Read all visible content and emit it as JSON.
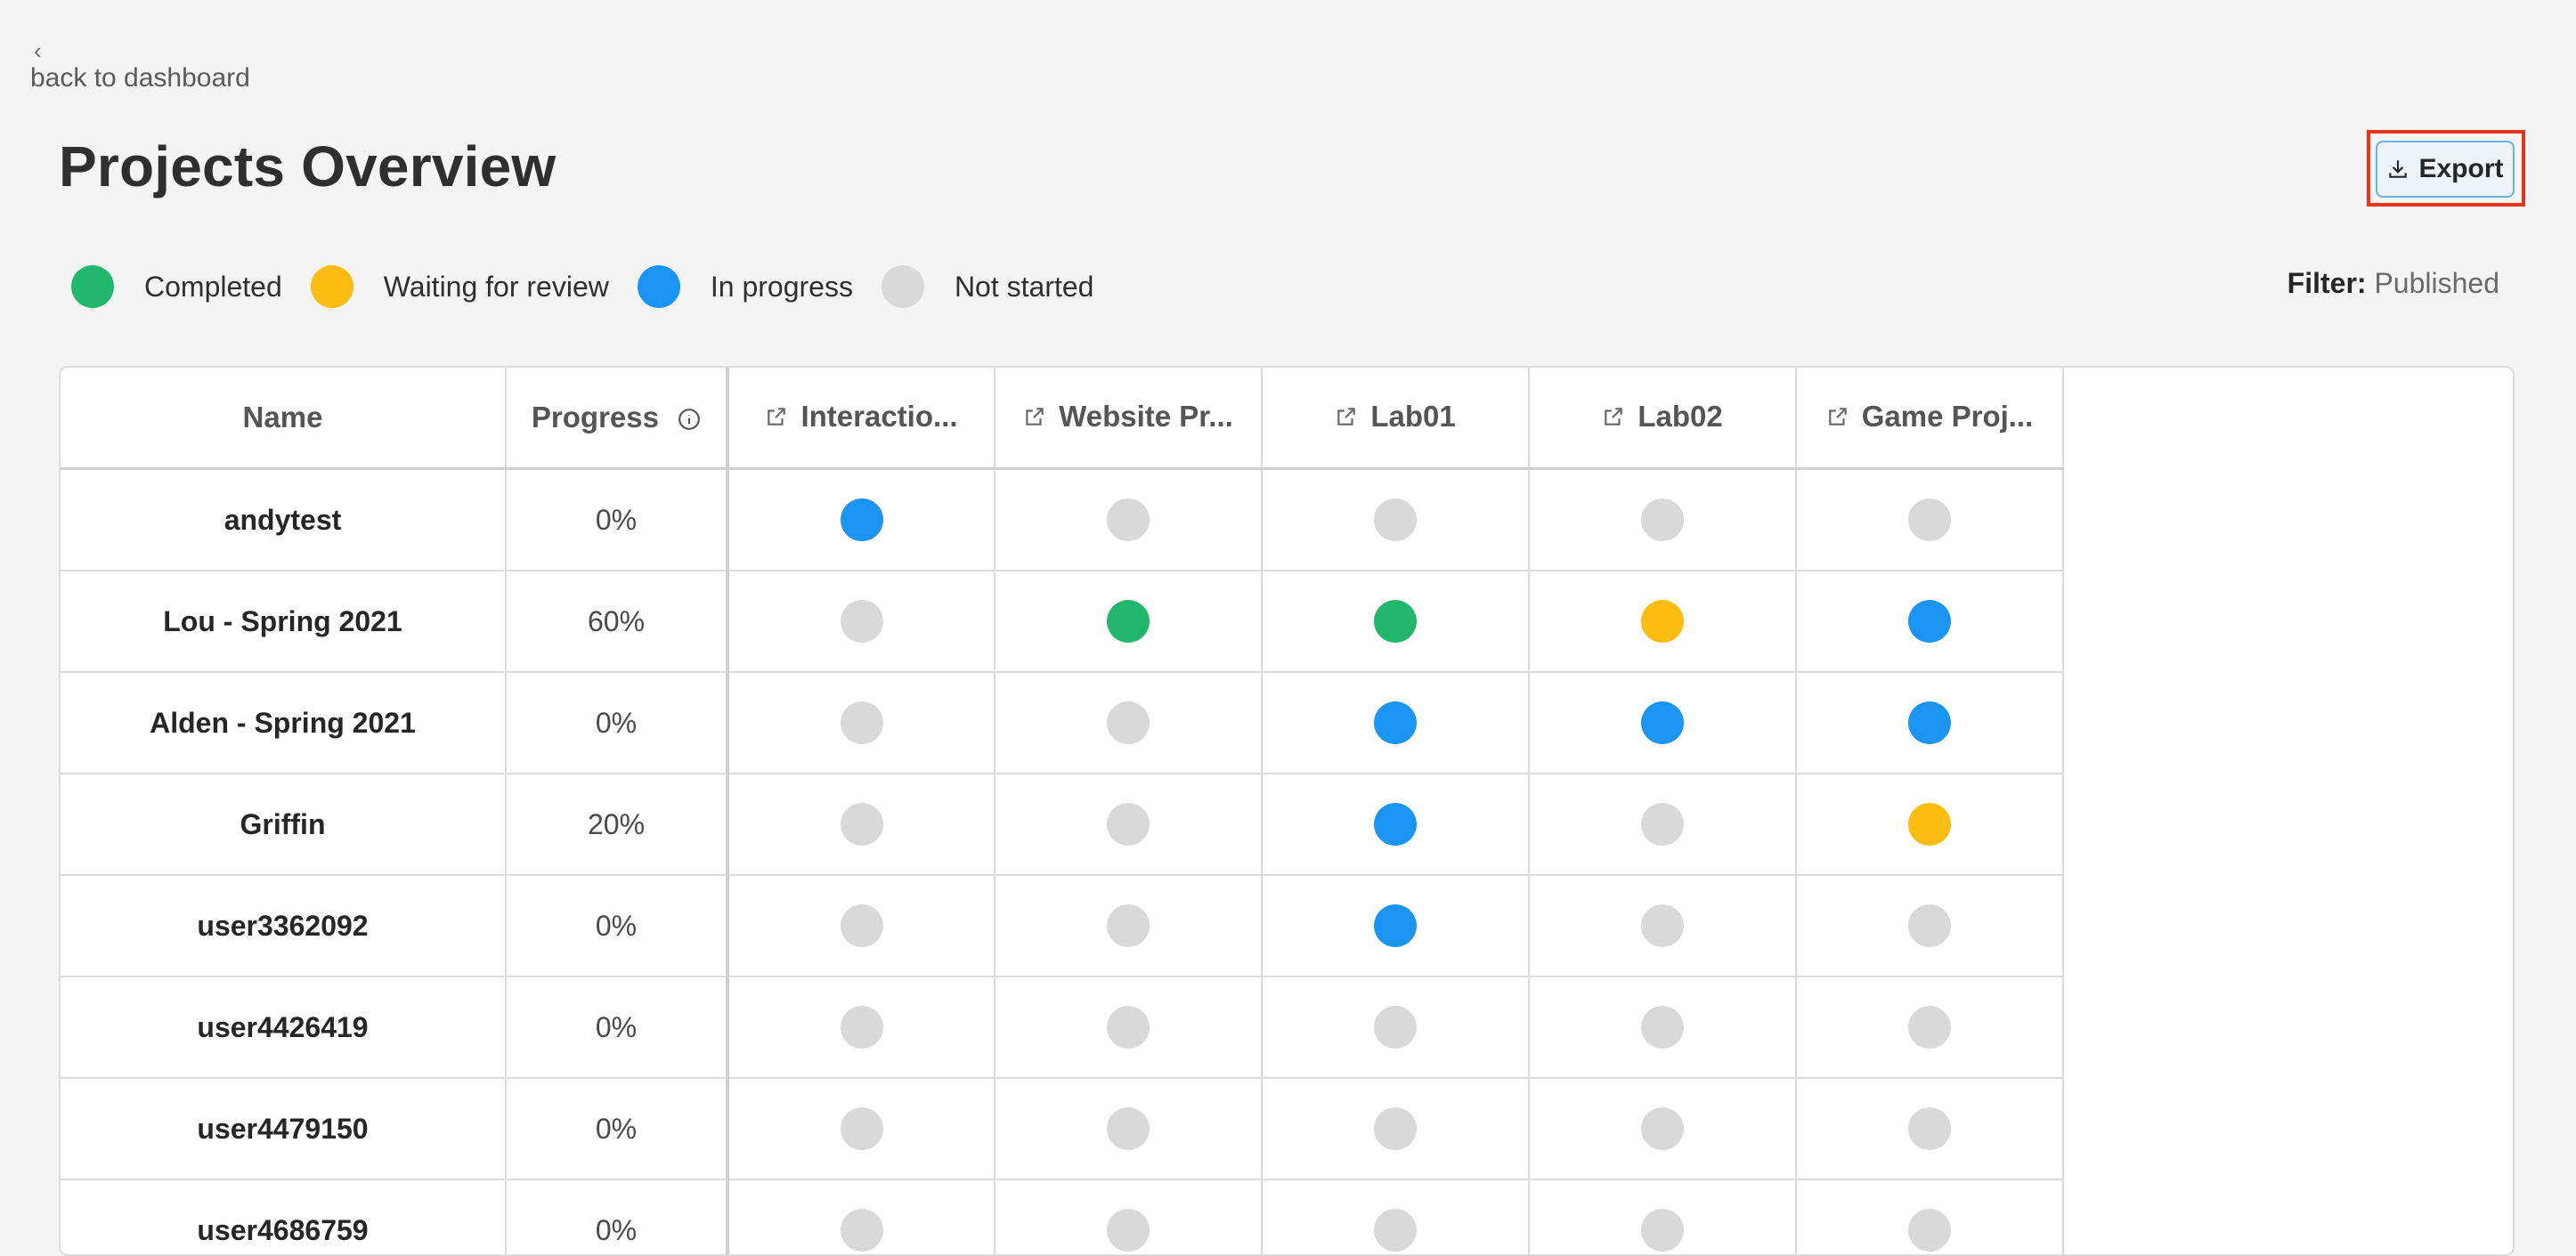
{
  "nav": {
    "back_chevron": "‹",
    "back_label": "back to dashboard"
  },
  "page": {
    "title": "Projects Overview"
  },
  "toolbar": {
    "export_label": "Export"
  },
  "colors": {
    "completed": "#21b86d",
    "waiting": "#fdbc12",
    "in_progress": "#1a94f5",
    "not_started": "#d9d9d9"
  },
  "legend": [
    {
      "status": "completed",
      "label": "Completed"
    },
    {
      "status": "waiting",
      "label": "Waiting for review"
    },
    {
      "status": "in_progress",
      "label": "In progress"
    },
    {
      "status": "not_started",
      "label": "Not started"
    }
  ],
  "filter": {
    "label": "Filter:",
    "value": "Published"
  },
  "table": {
    "name_header": "Name",
    "progress_header": "Progress",
    "projects": [
      "Interactio...",
      "Website Pr...",
      "Lab01",
      "Lab02",
      "Game Proj..."
    ],
    "rows": [
      {
        "name": "andytest",
        "progress": "0%",
        "statuses": [
          "in_progress",
          "not_started",
          "not_started",
          "not_started",
          "not_started"
        ]
      },
      {
        "name": "Lou - Spring 2021",
        "progress": "60%",
        "statuses": [
          "not_started",
          "completed",
          "completed",
          "waiting",
          "in_progress"
        ]
      },
      {
        "name": "Alden - Spring 2021",
        "progress": "0%",
        "statuses": [
          "not_started",
          "not_started",
          "in_progress",
          "in_progress",
          "in_progress"
        ]
      },
      {
        "name": "Griffin",
        "progress": "20%",
        "statuses": [
          "not_started",
          "not_started",
          "in_progress",
          "not_started",
          "waiting"
        ]
      },
      {
        "name": "user3362092",
        "progress": "0%",
        "statuses": [
          "not_started",
          "not_started",
          "in_progress",
          "not_started",
          "not_started"
        ]
      },
      {
        "name": "user4426419",
        "progress": "0%",
        "statuses": [
          "not_started",
          "not_started",
          "not_started",
          "not_started",
          "not_started"
        ]
      },
      {
        "name": "user4479150",
        "progress": "0%",
        "statuses": [
          "not_started",
          "not_started",
          "not_started",
          "not_started",
          "not_started"
        ]
      },
      {
        "name": "user4686759",
        "progress": "0%",
        "statuses": [
          "not_started",
          "not_started",
          "not_started",
          "not_started",
          "not_started"
        ]
      }
    ]
  }
}
